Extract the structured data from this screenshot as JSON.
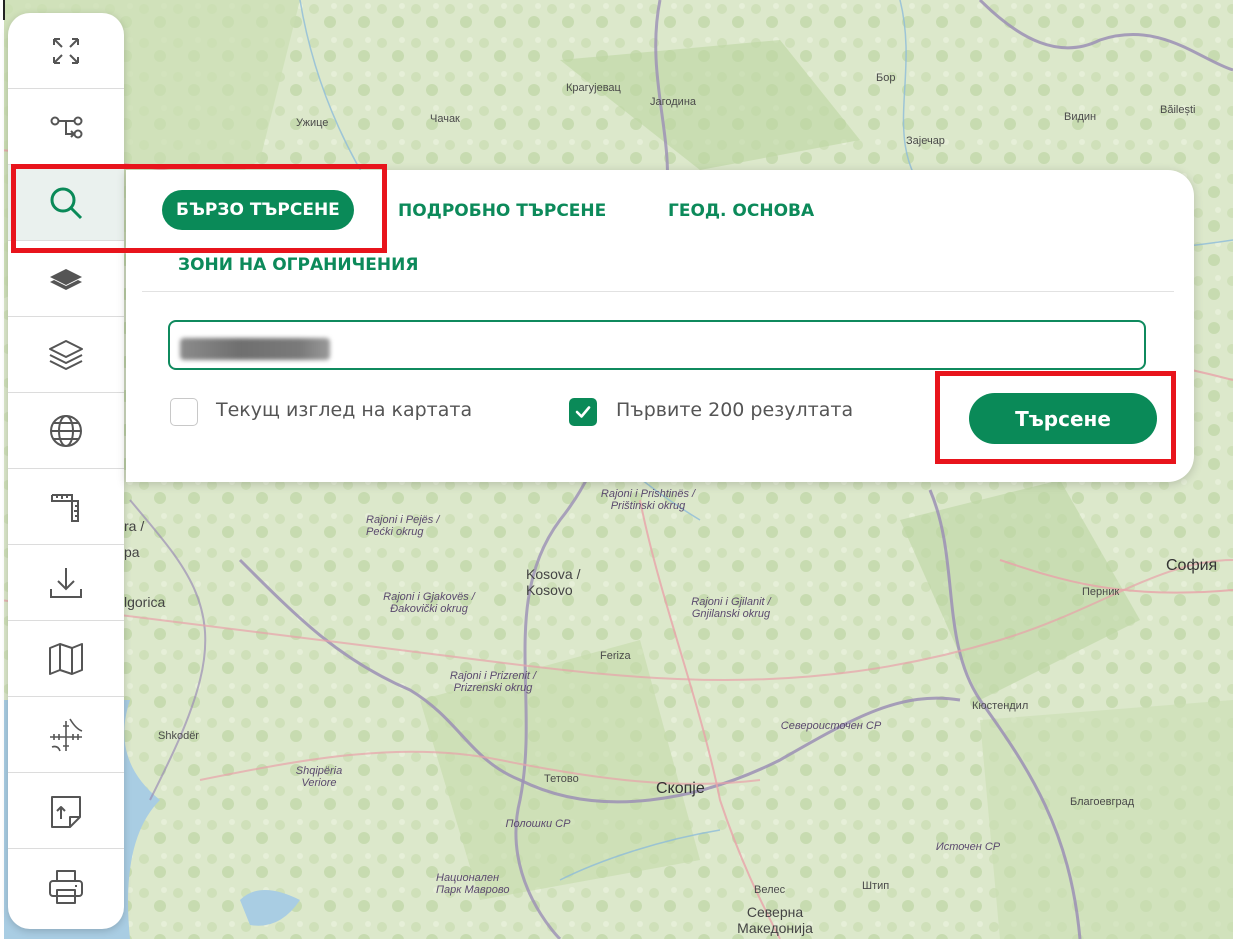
{
  "toolbar": {
    "items": [
      {
        "icon": "fullscreen-icon"
      },
      {
        "icon": "route-icon"
      },
      {
        "icon": "search-icon",
        "active": true
      },
      {
        "icon": "layers-filled-icon"
      },
      {
        "icon": "layers-outline-icon"
      },
      {
        "icon": "globe-icon"
      },
      {
        "icon": "measure-icon"
      },
      {
        "icon": "download-icon"
      },
      {
        "icon": "map-icon"
      },
      {
        "icon": "coordinates-icon"
      },
      {
        "icon": "upload-file-icon"
      },
      {
        "icon": "print-icon"
      }
    ]
  },
  "search_panel": {
    "tabs": [
      {
        "label": "БЪРЗО ТЪРСЕНЕ",
        "active": true
      },
      {
        "label": "ПОДРОБНО ТЪРСЕНЕ"
      },
      {
        "label": "ГЕОД. ОСНОВА"
      },
      {
        "label": "ЗОНИ НА ОГРАНИЧЕНИЯ"
      }
    ],
    "input_value": "",
    "options": [
      {
        "label": "Текущ изглед на картата",
        "checked": false
      },
      {
        "label": "Първите 200 резултата",
        "checked": true
      }
    ],
    "search_button": "Търсене"
  },
  "map_labels": [
    {
      "text": "Крагујевац"
    },
    {
      "text": "Јагодина"
    },
    {
      "text": "Бор"
    },
    {
      "text": "Ужице"
    },
    {
      "text": "Чачак"
    },
    {
      "text": "Зајечар"
    },
    {
      "text": "Видин"
    },
    {
      "text": "Băilești"
    },
    {
      "text": "Rajoni i Prishtinës / Prištinski okrug"
    },
    {
      "text": "Rajoni i Pejës / Pećki okrug"
    },
    {
      "text": "Kosova / Kosovo"
    },
    {
      "text": "Rajoni i Gjakovës / Đakovički okrug"
    },
    {
      "text": "Rajoni i Gjilanit / Gnjilanski okrug"
    },
    {
      "text": "Feriza"
    },
    {
      "text": "Rajoni i Prizrenit / Prizrenski okrug"
    },
    {
      "text": "София"
    },
    {
      "text": "Перник"
    },
    {
      "text": "Кюстендил"
    },
    {
      "text": "Североисточен СР"
    },
    {
      "text": "Shkodër"
    },
    {
      "text": "Shqipëria Veriore"
    },
    {
      "text": "Тетово"
    },
    {
      "text": "Скопје"
    },
    {
      "text": "Полошки СР"
    },
    {
      "text": "Благоевград"
    },
    {
      "text": "Источен СР"
    },
    {
      "text": "Велес"
    },
    {
      "text": "Штип"
    },
    {
      "text": "Национален Парк Маврово"
    },
    {
      "text": "Северна Македонија"
    },
    {
      "text": "ra /"
    },
    {
      "text": "pa"
    },
    {
      "text": "lgorica"
    }
  ],
  "colors": {
    "accent": "#0a8a58",
    "highlight": "#e8141c"
  }
}
